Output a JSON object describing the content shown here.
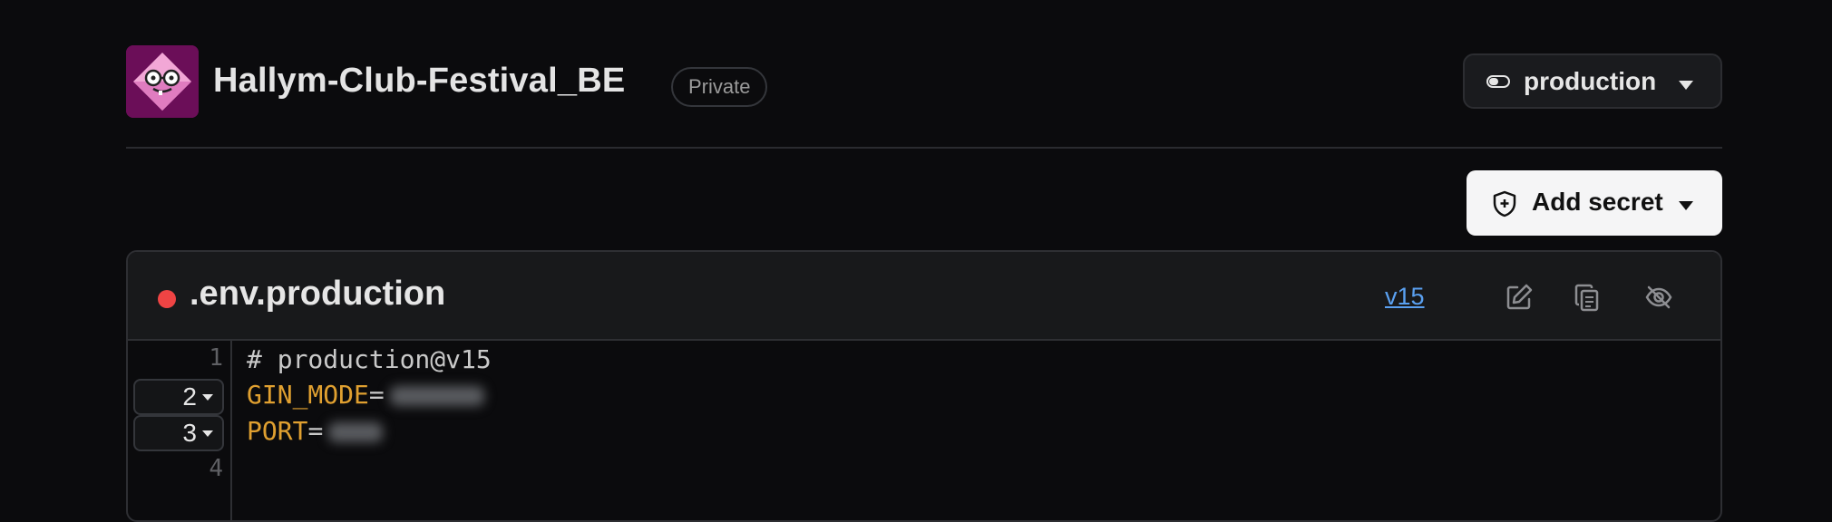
{
  "header": {
    "repo_name": "Hallym-Club-Festival_BE",
    "visibility": "Private",
    "avatar_icon": "owl-logo-icon",
    "environment": {
      "label": "production",
      "icon": "toggle-icon"
    }
  },
  "actions": {
    "add_secret_label": "Add secret",
    "add_secret_icon": "shield-plus-icon"
  },
  "file": {
    "name": ".env.production",
    "status_color": "#ef4444",
    "version": "v15",
    "tools": [
      "edit-icon",
      "copy-icon",
      "hide-icon"
    ]
  },
  "code": {
    "lines": [
      {
        "number": "1",
        "comment": "# production@v15"
      },
      {
        "number": "2",
        "key": "GIN_MODE",
        "eq": "=",
        "masked": true
      },
      {
        "number": "3",
        "key": "PORT",
        "eq": "=",
        "masked": true
      },
      {
        "number": "4"
      }
    ]
  },
  "colors": {
    "background": "#0b0b0d",
    "accent_link": "#5aa0f0",
    "key_color": "#e0a030"
  }
}
